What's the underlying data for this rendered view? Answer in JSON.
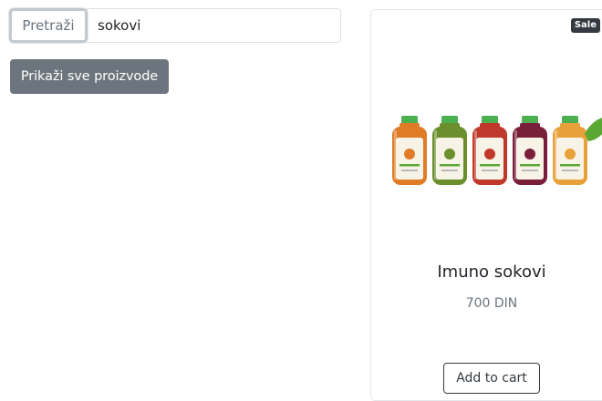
{
  "search": {
    "button_label": "Pretraži",
    "input_value": "sokovi"
  },
  "show_all_button": {
    "label": "Prikaži sve proizvode"
  },
  "product": {
    "badge": "Sale",
    "name": "Imuno sokovi",
    "price": "700 DIN",
    "add_to_cart_label": "Add to cart",
    "image": {
      "icon": "juice-bottles-image",
      "bottle_colors": [
        "#e07b26",
        "#6b8f2c",
        "#c0392b",
        "#7a1f3a",
        "#e8a13a"
      ],
      "cap_color": "#4caf50",
      "leaf_color": "#5aa832"
    }
  }
}
